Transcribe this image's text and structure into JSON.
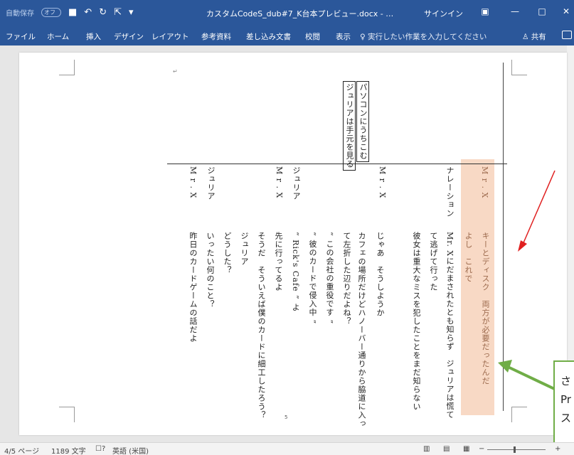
{
  "titlebar": {
    "autosave_label": "自動保存",
    "autosave_toggle": "オフ",
    "document_title": "カスタムCodeS_dub#7_K台本プレビュー.docx - …",
    "signin": "サインイン"
  },
  "ribbon": {
    "tabs": [
      "ファイル",
      "ホーム",
      "挿入",
      "デザイン",
      "レイアウト",
      "参考資料",
      "差し込み文書",
      "校閲",
      "表示"
    ],
    "tell_me": "実行したい作業を入力してください",
    "share": "共有"
  },
  "document": {
    "boxed_texts": [
      "パソコンにうちこむ",
      "ジュリアは手元を見る"
    ],
    "speakers": [
      "M r . X",
      "ジュリア",
      "M r . X",
      "ジュリア",
      "M r . X",
      "ナレーション",
      "M r . X"
    ],
    "lines": [
      "昨日のカードゲームの話だよ",
      "いったい何のこと？",
      "どうした？",
      "ジュリア",
      "そうだ　そういえば僕のカードに細工したろう？",
      "先に行ってるよ",
      "“ Rick's Cafe ” よ",
      "“ 彼のカードで侵入中 ”",
      "“ この会社の重役です ”",
      "て左折した辺りだよね？",
      "カフェの場所だけどハノーバー通りから脇道に入っ",
      "じゃあ　そうしようか",
      "彼女は重大なミスを犯したことをまだ知らない",
      "て逃げて行った",
      "Mr. Xにだまされたとも知らず　ジュリアは慌て",
      "よし　これで",
      "キーとディスク　両方が必要だったんだ"
    ],
    "page_number": "5"
  },
  "annotation": {
    "callout_text": [
      "さ",
      "Pr",
      "ス"
    ]
  },
  "statusbar": {
    "page": "4/5 ページ",
    "words": "1189 文字",
    "language": "英語 (米国)"
  },
  "colors": {
    "title_blue": "#2b579a",
    "highlight": "#f8d9c5",
    "arrow_red": "#e02020",
    "arrow_green": "#70ad47"
  }
}
